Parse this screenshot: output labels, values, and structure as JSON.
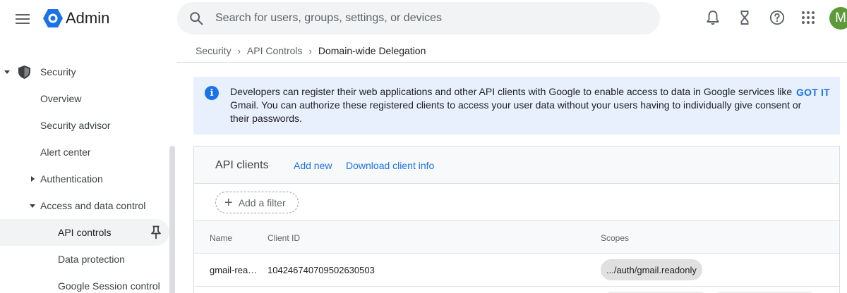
{
  "header": {
    "app_title": "Admin",
    "search_placeholder": "Search for users, groups, settings, or devices",
    "avatar_initial": "M",
    "icons": [
      "menu-icon",
      "admin-logo",
      "search-icon",
      "notifications-icon",
      "tasks-hourglass-icon",
      "help-icon",
      "apps-grid-icon"
    ]
  },
  "sidebar": {
    "section": "Security",
    "items": [
      {
        "label": "Overview"
      },
      {
        "label": "Security advisor"
      },
      {
        "label": "Alert center"
      },
      {
        "label": "Authentication"
      },
      {
        "label": "Access and data control"
      },
      {
        "label": "API controls"
      },
      {
        "label": "Data protection"
      },
      {
        "label": "Google Session control"
      }
    ]
  },
  "breadcrumb": [
    "Security",
    "API Controls",
    "Domain-wide Delegation"
  ],
  "banner": {
    "text": "Developers can register their web applications and other API clients with Google to enable access to data in Google services like Gmail. You can authorize these registered clients to access your user data without your users having to individually give consent or their passwords.",
    "action": "GOT IT"
  },
  "api_clients": {
    "title": "API clients",
    "add_new": "Add new",
    "download": "Download client info",
    "filter_label": "Add a filter",
    "columns": [
      "Name",
      "Client ID",
      "Scopes"
    ],
    "rows": [
      {
        "name": "gmail-rea…",
        "client_id": "104246740709502630503",
        "scope": ".../auth/gmail.readonly"
      }
    ]
  },
  "colors": {
    "accent": "#1a73e8",
    "banner_bg": "#e8f0fe",
    "avatar_bg": "#5f9a3a",
    "logo": "#1a73e8"
  }
}
